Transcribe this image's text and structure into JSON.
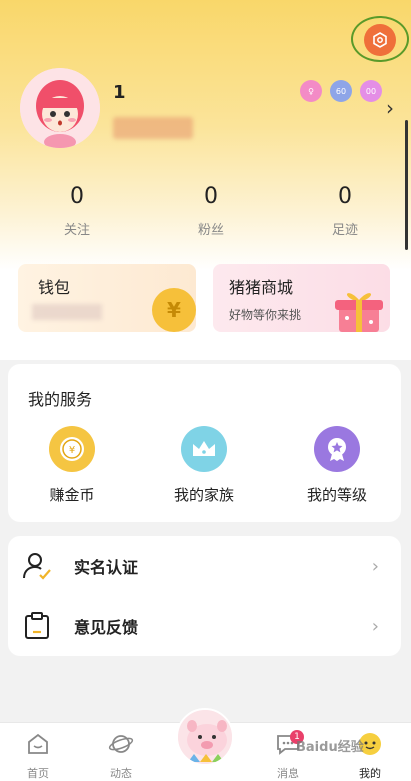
{
  "profile": {
    "username": "1",
    "badges": [
      "♀",
      "60",
      "00"
    ]
  },
  "stats": [
    {
      "value": "0",
      "label": "关注"
    },
    {
      "value": "0",
      "label": "粉丝"
    },
    {
      "value": "0",
      "label": "足迹"
    }
  ],
  "wallet": {
    "title": "钱包",
    "coin_symbol": "¥"
  },
  "shop": {
    "title": "猪猪商城",
    "subtitle": "好物等你来挑"
  },
  "services": {
    "title": "我的服务",
    "items": [
      {
        "label": "赚金币",
        "icon": "coin-icon",
        "color": "#f5c542"
      },
      {
        "label": "我的家族",
        "icon": "crown-icon",
        "color": "#7fd3e6"
      },
      {
        "label": "我的等级",
        "icon": "level-badge-icon",
        "color": "#9a78e0"
      }
    ]
  },
  "list": [
    {
      "label": "实名认证",
      "icon": "user-verify-icon"
    },
    {
      "label": "意见反馈",
      "icon": "feedback-icon"
    }
  ],
  "tabbar": {
    "tabs": [
      {
        "label": "首页",
        "icon": "home-icon"
      },
      {
        "label": "动态",
        "icon": "planet-icon"
      },
      {
        "label": "消息",
        "icon": "message-icon",
        "badge": "1"
      },
      {
        "label": "我的",
        "icon": "profile-icon",
        "active": true
      }
    ]
  },
  "watermark": "Baidu经验",
  "colors": {
    "accent": "#f9d76a",
    "settings": "#ef6f3a",
    "highlight_ring": "#5a9a2a"
  }
}
